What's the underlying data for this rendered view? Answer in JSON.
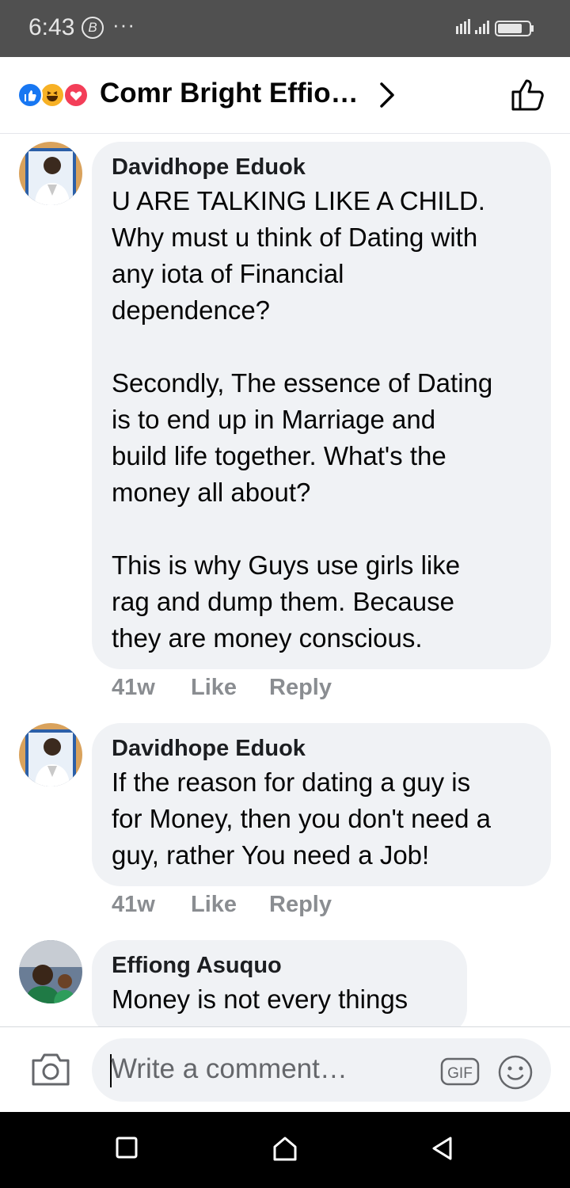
{
  "status_bar": {
    "time": "6:43",
    "b_badge": "B",
    "dots": "···"
  },
  "header": {
    "title": "Comr Bright Effio…",
    "reactions": [
      "like",
      "haha",
      "love"
    ]
  },
  "comments": [
    {
      "author": "Davidhope Eduok",
      "paragraphs": [
        [
          "U ARE TALKING LIKE A CHILD.",
          "Why must u think of Dating with",
          "any iota of Financial",
          "dependence?"
        ],
        [
          "Secondly, The essence of Dating",
          "is to end up in Marriage and",
          "build life together. What's the",
          "money all about?"
        ],
        [
          "This is why Guys use girls like",
          "rag and dump them. Because",
          "they are money conscious."
        ]
      ],
      "time": "41w",
      "like": "Like",
      "reply": "Reply"
    },
    {
      "author": "Davidhope Eduok",
      "paragraphs": [
        [
          "If the reason for dating a guy is",
          "for Money, then you don't need a",
          "guy, rather You need a Job!"
        ]
      ],
      "time": "41w",
      "like": "Like",
      "reply": "Reply"
    },
    {
      "author": "Effiong Asuquo",
      "paragraphs": [
        [
          "Money is not every things"
        ]
      ]
    }
  ],
  "composer": {
    "placeholder": "Write a comment…",
    "gif_label": "GIF"
  },
  "colors": {
    "bubble": "#f0f2f5",
    "secondary_text": "#8a8d91",
    "like_blue": "#1877f2",
    "love_red": "#f33e58",
    "haha_yellow": "#f7b125"
  }
}
